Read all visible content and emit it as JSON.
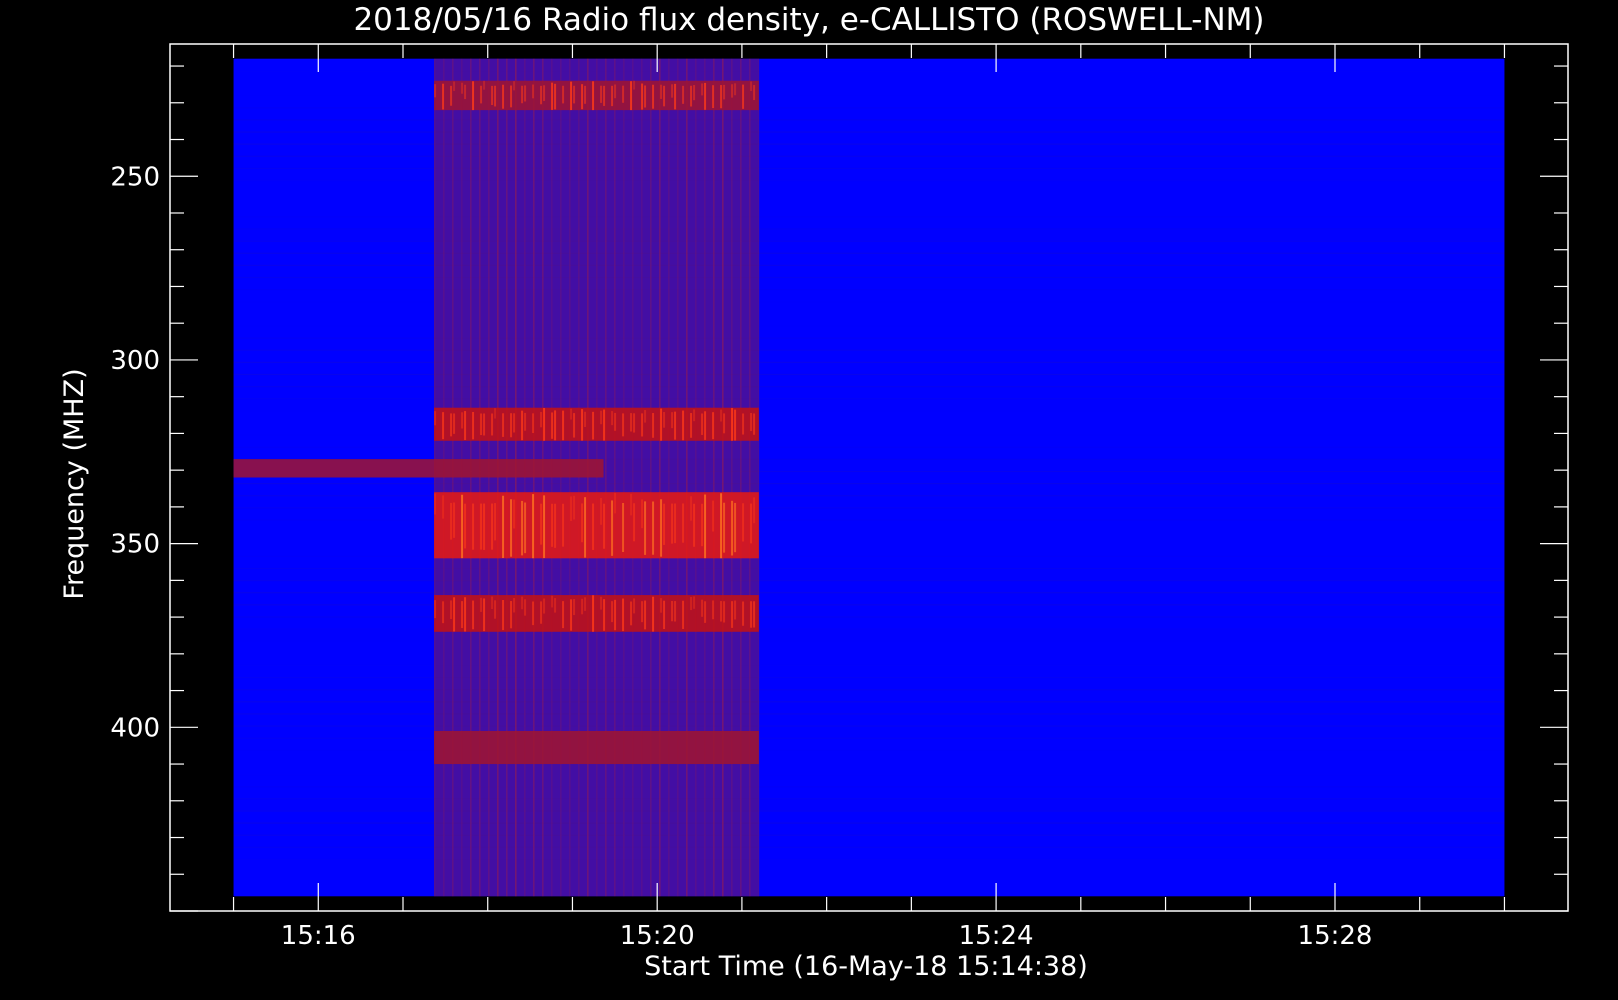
{
  "chart_data": {
    "type": "heatmap",
    "title": "2018/05/16  Radio flux density, e-CALLISTO (ROSWELL-NM)",
    "xlabel": "Start Time (16-May-18 15:14:38)",
    "ylabel": "Frequency (MHZ)",
    "x_start": "15:15:00",
    "x_end": "15:30:00",
    "xlim": [
      "15:14:15",
      "15:30:45"
    ],
    "ylim": [
      450,
      214
    ],
    "y_inverted": true,
    "y_data_range": [
      218,
      446
    ],
    "x_ticks": [
      "15:16",
      "15:20",
      "15:24",
      "15:28"
    ],
    "y_ticks": [
      250,
      300,
      350,
      400
    ],
    "colormap": [
      "#0000ff",
      "#8a1a6e",
      "#cc1010",
      "#ff7020"
    ],
    "grid": false,
    "legend": "none",
    "bursts": [
      {
        "t_start": "15:17:22",
        "t_end": "15:21:12",
        "f_low": 218,
        "f_high": 446,
        "level": 0.5
      },
      {
        "t_start": "15:17:22",
        "t_end": "15:21:12",
        "f_low": 313,
        "f_high": 322,
        "level": 0.9
      },
      {
        "t_start": "15:17:22",
        "t_end": "15:21:12",
        "f_low": 336,
        "f_high": 354,
        "level": 1.0
      },
      {
        "t_start": "15:17:22",
        "t_end": "15:21:12",
        "f_low": 364,
        "f_high": 374,
        "level": 0.85
      },
      {
        "t_start": "15:17:22",
        "t_end": "15:21:12",
        "f_low": 224,
        "f_high": 232,
        "level": 0.75
      },
      {
        "t_start": "15:17:22",
        "t_end": "15:21:12",
        "f_low": 401,
        "f_high": 410,
        "level": 0.65
      },
      {
        "t_start": "15:15:00",
        "t_end": "15:19:22",
        "f_low": 327,
        "f_high": 332,
        "level": 0.6
      }
    ]
  },
  "colors": {
    "background": "#000000",
    "axes": "#ffffff",
    "text": "#ffffff",
    "low": "#0000ff",
    "high": "#ff3010"
  }
}
